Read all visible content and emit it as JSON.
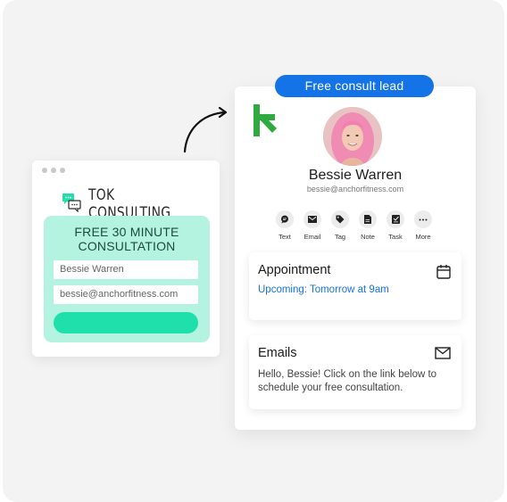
{
  "colors": {
    "background": "#f3f3f3",
    "form_panel": "#b3f3df",
    "submit_button": "#1fe0ab",
    "accent_blue": "#1473e6",
    "brand_green": "#2eaa3f"
  },
  "form_widget": {
    "brand_name": "TOK CONSULTING",
    "brand_icon": "chat-bubbles-icon",
    "title_line1": "FREE 30 MINUTE",
    "title_line2": "CONSULTATION",
    "name_value": "Bessie Warren",
    "email_value": "bessie@anchorfitness.com",
    "submit_label": ""
  },
  "contact_card": {
    "badge": "Free consult lead",
    "logo": "k-logo-icon",
    "name": "Bessie Warren",
    "email": "bessie@anchorfitness.com",
    "actions": [
      {
        "label": "Text",
        "icon": "chat-icon"
      },
      {
        "label": "Email",
        "icon": "envelope-icon"
      },
      {
        "label": "Tag",
        "icon": "tag-icon"
      },
      {
        "label": "Note",
        "icon": "note-icon"
      },
      {
        "label": "Task",
        "icon": "task-icon"
      },
      {
        "label": "More",
        "icon": "more-icon"
      }
    ],
    "appointment": {
      "title": "Appointment",
      "status": "Upcoming: Tomorrow at 9am",
      "icon": "calendar-icon"
    },
    "emails": {
      "title": "Emails",
      "preview": "Hello, Bessie! Click on the link below to schedule your free consultation.",
      "icon": "envelope-icon"
    }
  }
}
